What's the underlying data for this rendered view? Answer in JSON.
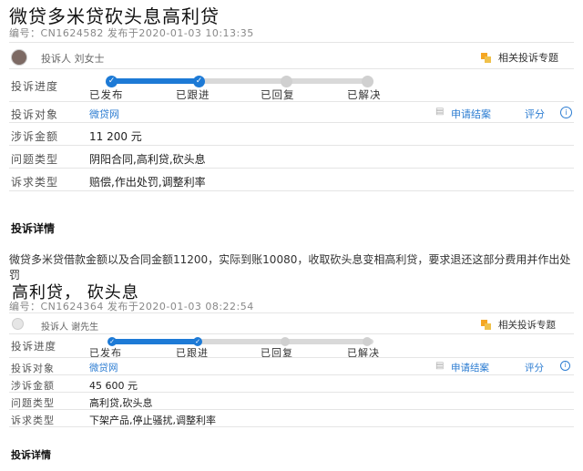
{
  "complaints": [
    {
      "title": "微贷多米贷砍头息高利贷",
      "meta": "编号：CN1624582    发布于2020-01-03 10:13:35",
      "complainer": "投诉人 刘女士",
      "topic_link": "相关投诉专题",
      "progress_label": "投诉进度",
      "steps": [
        "已发布",
        "已跟进",
        "已回复",
        "已解决"
      ],
      "steps_completed": 2,
      "target_label": "投诉对象",
      "target_value": "微贷网",
      "apply_close": "申请结案",
      "rate": "评分",
      "amount_label": "涉诉金额",
      "amount_value": "11 200 元",
      "issue_label": "问题类型",
      "issue_value": "阴阳合同,高利贷,砍头息",
      "demand_label": "诉求类型",
      "demand_value": "赔偿,作出处罚,调整利率",
      "details_heading": "投诉详情",
      "details_text": "微贷多米贷借款金额以及合同金额11200，实际到账10080，收取砍头息变相高利贷，要求退还这部分费用并作出处罚"
    },
    {
      "title": "高利贷， 砍头息",
      "meta": "编号：CN1624364    发布于2020-01-03 08:22:54",
      "complainer": "投诉人 谢先生",
      "topic_link": "相关投诉专题",
      "progress_label": "投诉进度",
      "steps": [
        "已发布",
        "已跟进",
        "已回复",
        "已解决"
      ],
      "steps_completed": 2,
      "target_label": "投诉对象",
      "target_value": "微贷网",
      "apply_close": "申请结案",
      "rate": "评分",
      "amount_label": "涉诉金额",
      "amount_value": "45 600 元",
      "issue_label": "问题类型",
      "issue_value": "高利贷,砍头息",
      "demand_label": "诉求类型",
      "demand_value": "下架产品,停止骚扰,调整利率",
      "details_heading": "投诉详情"
    }
  ]
}
